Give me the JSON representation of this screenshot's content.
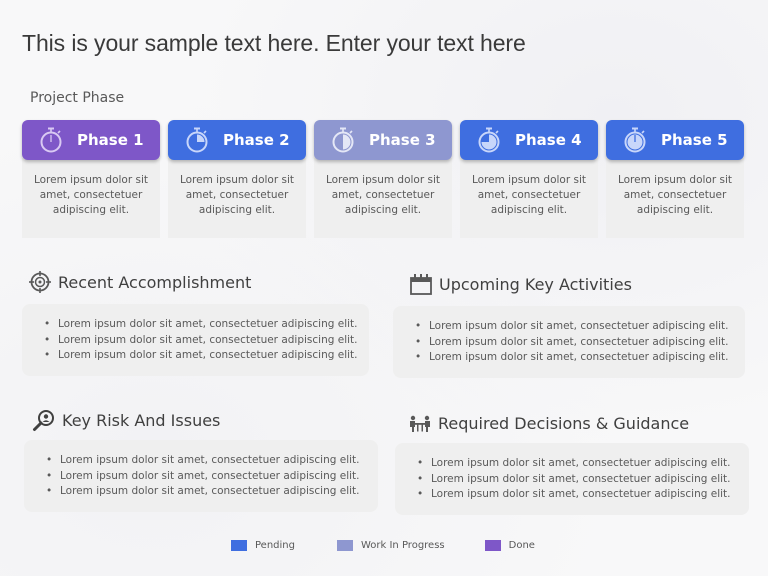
{
  "title": "This is your sample text here. Enter your text here",
  "project_phase_label": "Project Phase",
  "colors": {
    "done": "#7e57c8",
    "pending": "#3f6ee0",
    "work_in_progress": "#8e97d0"
  },
  "phases": [
    {
      "label": "Phase 1",
      "status": "done",
      "color": "#7e57c8",
      "progress_icon": "stopwatch-empty",
      "text": "Lorem ipsum dolor sit amet, consectetuer adipiscing elit."
    },
    {
      "label": "Phase 2",
      "status": "pending",
      "color": "#3f6ee0",
      "progress_icon": "stopwatch-quarter",
      "text": "Lorem ipsum dolor sit amet, consectetuer adipiscing elit."
    },
    {
      "label": "Phase 3",
      "status": "work_in_progress",
      "color": "#8e97d0",
      "progress_icon": "stopwatch-half",
      "text": "Lorem ipsum dolor sit amet, consectetuer adipiscing elit."
    },
    {
      "label": "Phase 4",
      "status": "pending",
      "color": "#3f6ee0",
      "progress_icon": "stopwatch-three-quarter",
      "text": "Lorem ipsum dolor sit amet, consectetuer adipiscing elit."
    },
    {
      "label": "Phase 5",
      "status": "pending",
      "color": "#3f6ee0",
      "progress_icon": "stopwatch-full",
      "text": "Lorem ipsum dolor sit amet, consectetuer adipiscing elit."
    }
  ],
  "blocks": {
    "recent": {
      "title": "Recent Accomplishment",
      "icon": "target-icon",
      "items": [
        "Lorem ipsum dolor sit amet, consectetuer adipiscing elit.",
        "Lorem ipsum dolor sit amet, consectetuer adipiscing elit.",
        "Lorem ipsum dolor sit amet, consectetuer adipiscing elit."
      ]
    },
    "upcoming": {
      "title": "Upcoming Key Activities",
      "icon": "calendar-icon",
      "items": [
        "Lorem ipsum dolor sit amet, consectetuer adipiscing elit.",
        "Lorem ipsum dolor sit amet, consectetuer adipiscing elit.",
        "Lorem ipsum dolor sit amet, consectetuer adipiscing elit."
      ]
    },
    "risks": {
      "title": "Key Risk And Issues",
      "icon": "magnifier-person-icon",
      "items": [
        "Lorem ipsum dolor sit amet, consectetuer adipiscing elit.",
        "Lorem ipsum dolor sit amet, consectetuer adipiscing elit.",
        "Lorem ipsum dolor sit amet, consectetuer adipiscing elit."
      ]
    },
    "decisions": {
      "title": "Required Decisions & Guidance",
      "icon": "meeting-icon",
      "items": [
        "Lorem ipsum dolor sit amet, consectetuer adipiscing elit.",
        "Lorem ipsum dolor sit amet, consectetuer adipiscing elit.",
        "Lorem ipsum dolor sit amet, consectetuer adipiscing elit."
      ]
    }
  },
  "legend": [
    {
      "label": "Pending",
      "color": "#3f6ee0"
    },
    {
      "label": "Work In Progress",
      "color": "#8e97d0"
    },
    {
      "label": "Done",
      "color": "#7e57c8"
    }
  ]
}
